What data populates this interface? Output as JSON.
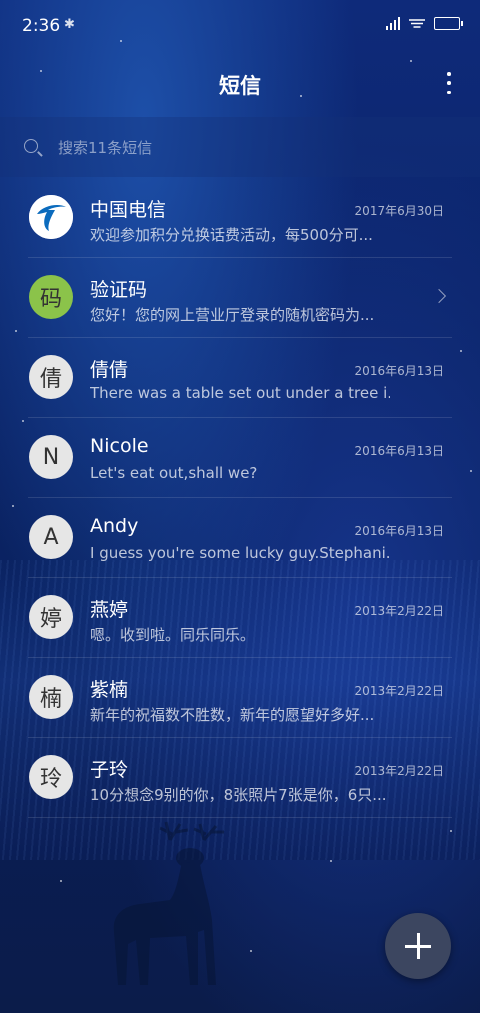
{
  "status_bar": {
    "time": "2:36"
  },
  "header": {
    "title": "短信"
  },
  "search": {
    "placeholder": "搜索11条短信"
  },
  "conversations": [
    {
      "sender": "中国电信",
      "preview": "欢迎参加积分兑换话费活动，每500分可...",
      "date": "2017年6月30日",
      "avatar": "telecom-logo"
    },
    {
      "sender": "验证码",
      "preview": "您好！您的网上营业厅登录的随机密码为...",
      "date": "",
      "avatar_text": "码"
    },
    {
      "sender": "倩倩",
      "preview": "There was a table set out under a tree i...",
      "date": "2016年6月13日",
      "avatar_text": "倩"
    },
    {
      "sender": "Nicole",
      "preview": "Let's eat out,shall we?",
      "date": "2016年6月13日",
      "avatar_text": "N"
    },
    {
      "sender": "Andy",
      "preview": "I guess you're some lucky guy.Stephani...",
      "date": "2016年6月13日",
      "avatar_text": "A"
    },
    {
      "sender": "燕婷",
      "preview": "嗯。收到啦。同乐同乐。",
      "date": "2013年2月22日",
      "avatar_text": "婷"
    },
    {
      "sender": "紫楠",
      "preview": "新年的祝福数不胜数，新年的愿望好多好...",
      "date": "2013年2月22日",
      "avatar_text": "楠"
    },
    {
      "sender": "子玲",
      "preview": "10分想念9别的你，8张照片7张是你，6只...",
      "date": "2013年2月22日",
      "avatar_text": "玲"
    }
  ],
  "colors": {
    "background": "#0b2468",
    "avatar_green": "#8bc34a",
    "fab": "#3c4660"
  },
  "icons": {
    "compose": "plus-icon",
    "menu": "more-vert-icon",
    "search": "search-icon"
  }
}
